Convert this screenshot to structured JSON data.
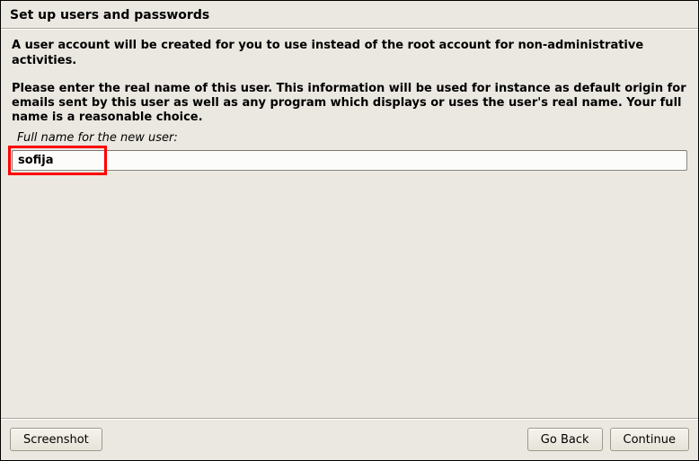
{
  "title": "Set up users and passwords",
  "intro": "A user account will be created for you to use instead of the root account for non-administrative activities.",
  "instruction": "Please enter the real name of this user. This information will be used for instance as default origin for emails sent by this user as well as any program which displays or uses the user's real name. Your full name is a reasonable choice.",
  "field_label": "Full name for the new user:",
  "input_value": "sofija",
  "buttons": {
    "screenshot": "Screenshot",
    "go_back": "Go Back",
    "continue": "Continue"
  }
}
